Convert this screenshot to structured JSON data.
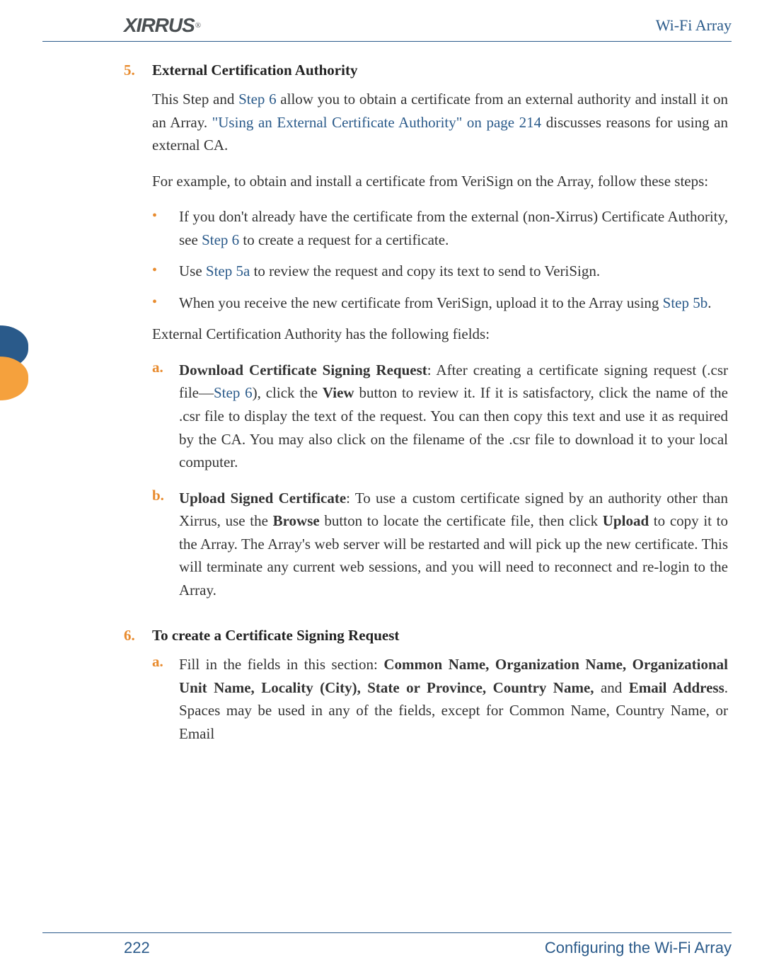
{
  "header": {
    "logo_text": "XIRRUS",
    "title": "Wi-Fi Array"
  },
  "step5": {
    "num": "5.",
    "title": "External Certification Authority",
    "para1_a": "This Step and ",
    "para1_link1": "Step 6",
    "para1_b": " allow you to obtain a certificate from an external authority and install it on an Array. ",
    "para1_link2": "\"Using an External Certificate Authority\" on page 214",
    "para1_c": " discusses reasons for using an external CA.",
    "para2": "For example, to obtain and install a certificate from VeriSign on the Array, follow these steps:",
    "bullets": [
      {
        "a": "If you don't already have the certificate from the external (non-Xirrus) Certificate Authority, see ",
        "link": "Step 6",
        "b": " to create a request for a certificate."
      },
      {
        "a": "Use ",
        "link": "Step 5a",
        "b": " to review the request and copy its text to send to VeriSign."
      },
      {
        "a": "When you receive the new certificate from VeriSign, upload it to the Array using ",
        "link": "Step 5b",
        "b": "."
      }
    ],
    "para3": "External Certification Authority has the following fields:",
    "sub_a": {
      "letter": "a.",
      "bold1": "Download Certificate Signing Request",
      "text1": ": After creating a certificate signing request (.csr file—",
      "link": "Step 6",
      "text2": "), click the ",
      "bold2": "View",
      "text3": " button to review it. If it is satisfactory, click the name of the .csr file to display the text of the request. You can then copy this text and use it as required by the CA. You may also click on the filename of the .csr file to download it to your local computer."
    },
    "sub_b": {
      "letter": "b.",
      "bold1": "Upload Signed Certificate",
      "text1": ": To use a custom certificate signed by an authority other than Xirrus, use the ",
      "bold2": "Browse",
      "text2": " button to locate the certificate file, then click ",
      "bold3": "Upload",
      "text3": " to copy it to the Array. The Array's web server will be restarted and will pick up the new certificate. This will terminate any current web sessions, and you will need to reconnect and re-login to the Array."
    }
  },
  "step6": {
    "num": "6.",
    "title": "To create a Certificate Signing Request",
    "sub_a": {
      "letter": "a.",
      "text1": "Fill in the fields in this section: ",
      "bold1": "Common Name, Organization Name, Organizational Unit Name, Locality (City), State or Province, Country Name,",
      "text2": " and ",
      "bold2": "Email Address",
      "text3": ". Spaces may be used in any of the fields, except for Common Name, Country Name, or Email"
    }
  },
  "footer": {
    "page_num": "222",
    "title": "Configuring the Wi-Fi Array"
  }
}
